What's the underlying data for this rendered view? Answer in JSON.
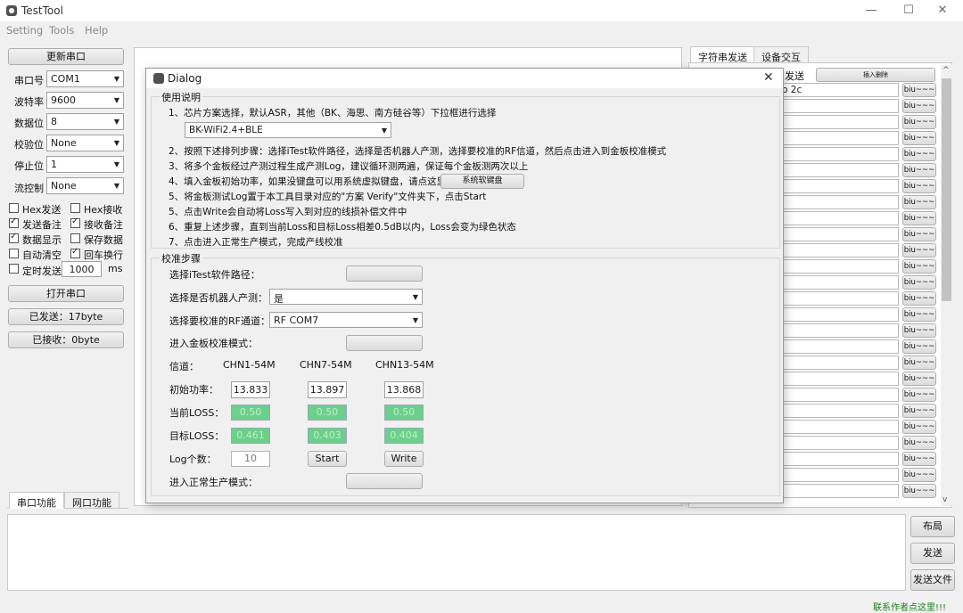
{
  "window": {
    "title": "TestTool",
    "controls": {
      "minimize": "—",
      "maximize": "☐",
      "close": "✕"
    }
  },
  "menu": [
    "Setting",
    "Tools",
    "Help"
  ],
  "left": {
    "refresh_button": "更新串口",
    "fields": [
      {
        "label": "串口号",
        "value": "COM1"
      },
      {
        "label": "波特率",
        "value": "9600"
      },
      {
        "label": "数据位",
        "value": "8"
      },
      {
        "label": "校验位",
        "value": "None"
      },
      {
        "label": "停止位",
        "value": "1"
      },
      {
        "label": "流控制",
        "value": "None"
      }
    ],
    "checks": [
      {
        "label": "Hex发送",
        "checked": false
      },
      {
        "label": "Hex接收",
        "checked": false
      },
      {
        "label": "发送备注",
        "checked": true
      },
      {
        "label": "接收备注",
        "checked": true
      },
      {
        "label": "数据显示",
        "checked": true
      },
      {
        "label": "保存数据",
        "checked": false
      },
      {
        "label": "自动清空",
        "checked": false
      },
      {
        "label": "回车换行",
        "checked": true
      },
      {
        "label": "定时发送",
        "checked": false
      }
    ],
    "timer_value": "1000",
    "timer_unit": "ms",
    "open_button": "打开串口",
    "sent_button": "已发送：17byte",
    "received_button": "已接收：0byte",
    "bottom_tabs": [
      "串口功能",
      "网口功能"
    ]
  },
  "right": {
    "tabs": [
      "字符串发送",
      "设备交互"
    ],
    "header_label": "发送",
    "header_button": "插入删除",
    "first_row_value": "o 2c",
    "row_button": "biu~~~",
    "rows": 26
  },
  "bottom_buttons": [
    "布局",
    "发送",
    "发送文件"
  ],
  "footer_link": "联系作者点这里!!!",
  "dialog": {
    "title": "Dialog",
    "close": "✕",
    "usage_title": "使用说明",
    "step1": "1、芯片方案选择，默认ASR，其他（BK、海思、南方硅谷等）下拉框进行选择",
    "chip_select": "BK-WiFi2.4+BLE",
    "step2": "2、按照下述排列步骤：选择iTest软件路径，选择是否机器人产测，选择要校准的RF信道，然后点击进入到金板校准模式",
    "step3": "3、将多个金板经过产测过程生成产测Log，建议循环测两遍，保证每个金板测两次以上",
    "step4": "4、填入金板初始功率，如果没键盘可以用系统虚拟键盘，请点这里：",
    "vkbd_button": "系统软键盘",
    "step5a": "5、将金板测试Log置于本工具目录对应的\"方案 Verify\"文件夹下，点击Start",
    "step5b": "5、点击Write会自动将Loss写入到对应的线损补偿文件中",
    "step6": "6、重复上述步骤，直到当前Loss和目标Loss相差0.5dB以内，Loss会变为绿色状态",
    "step7": "7、点击进入正常生产模式，完成产线校准",
    "calib_title": "校准步骤",
    "path_label": "选择iTest软件路径：",
    "robot_label": "选择是否机器人产测：",
    "robot_value": "是",
    "rf_label": "选择要校准的RF通道：",
    "rf_value": "RF COM7",
    "golden_label": "进入金板校准模式：",
    "channel_label": "信道：",
    "channels": [
      "CHN1-54M",
      "CHN7-54M",
      "CHN13-54M"
    ],
    "init_power_label": "初始功率：",
    "init_power": [
      "13.833",
      "13.897",
      "13.868"
    ],
    "current_loss_label": "当前LOSS：",
    "current_loss": [
      "0.50",
      "0.50",
      "0.50"
    ],
    "target_loss_label": "目标LOSS：",
    "target_loss": [
      "0.461",
      "0.403",
      "0.404"
    ],
    "log_count_label": "Log个数：",
    "log_count": "10",
    "start_button": "Start",
    "write_button": "Write",
    "normal_label": "进入正常生产模式："
  }
}
